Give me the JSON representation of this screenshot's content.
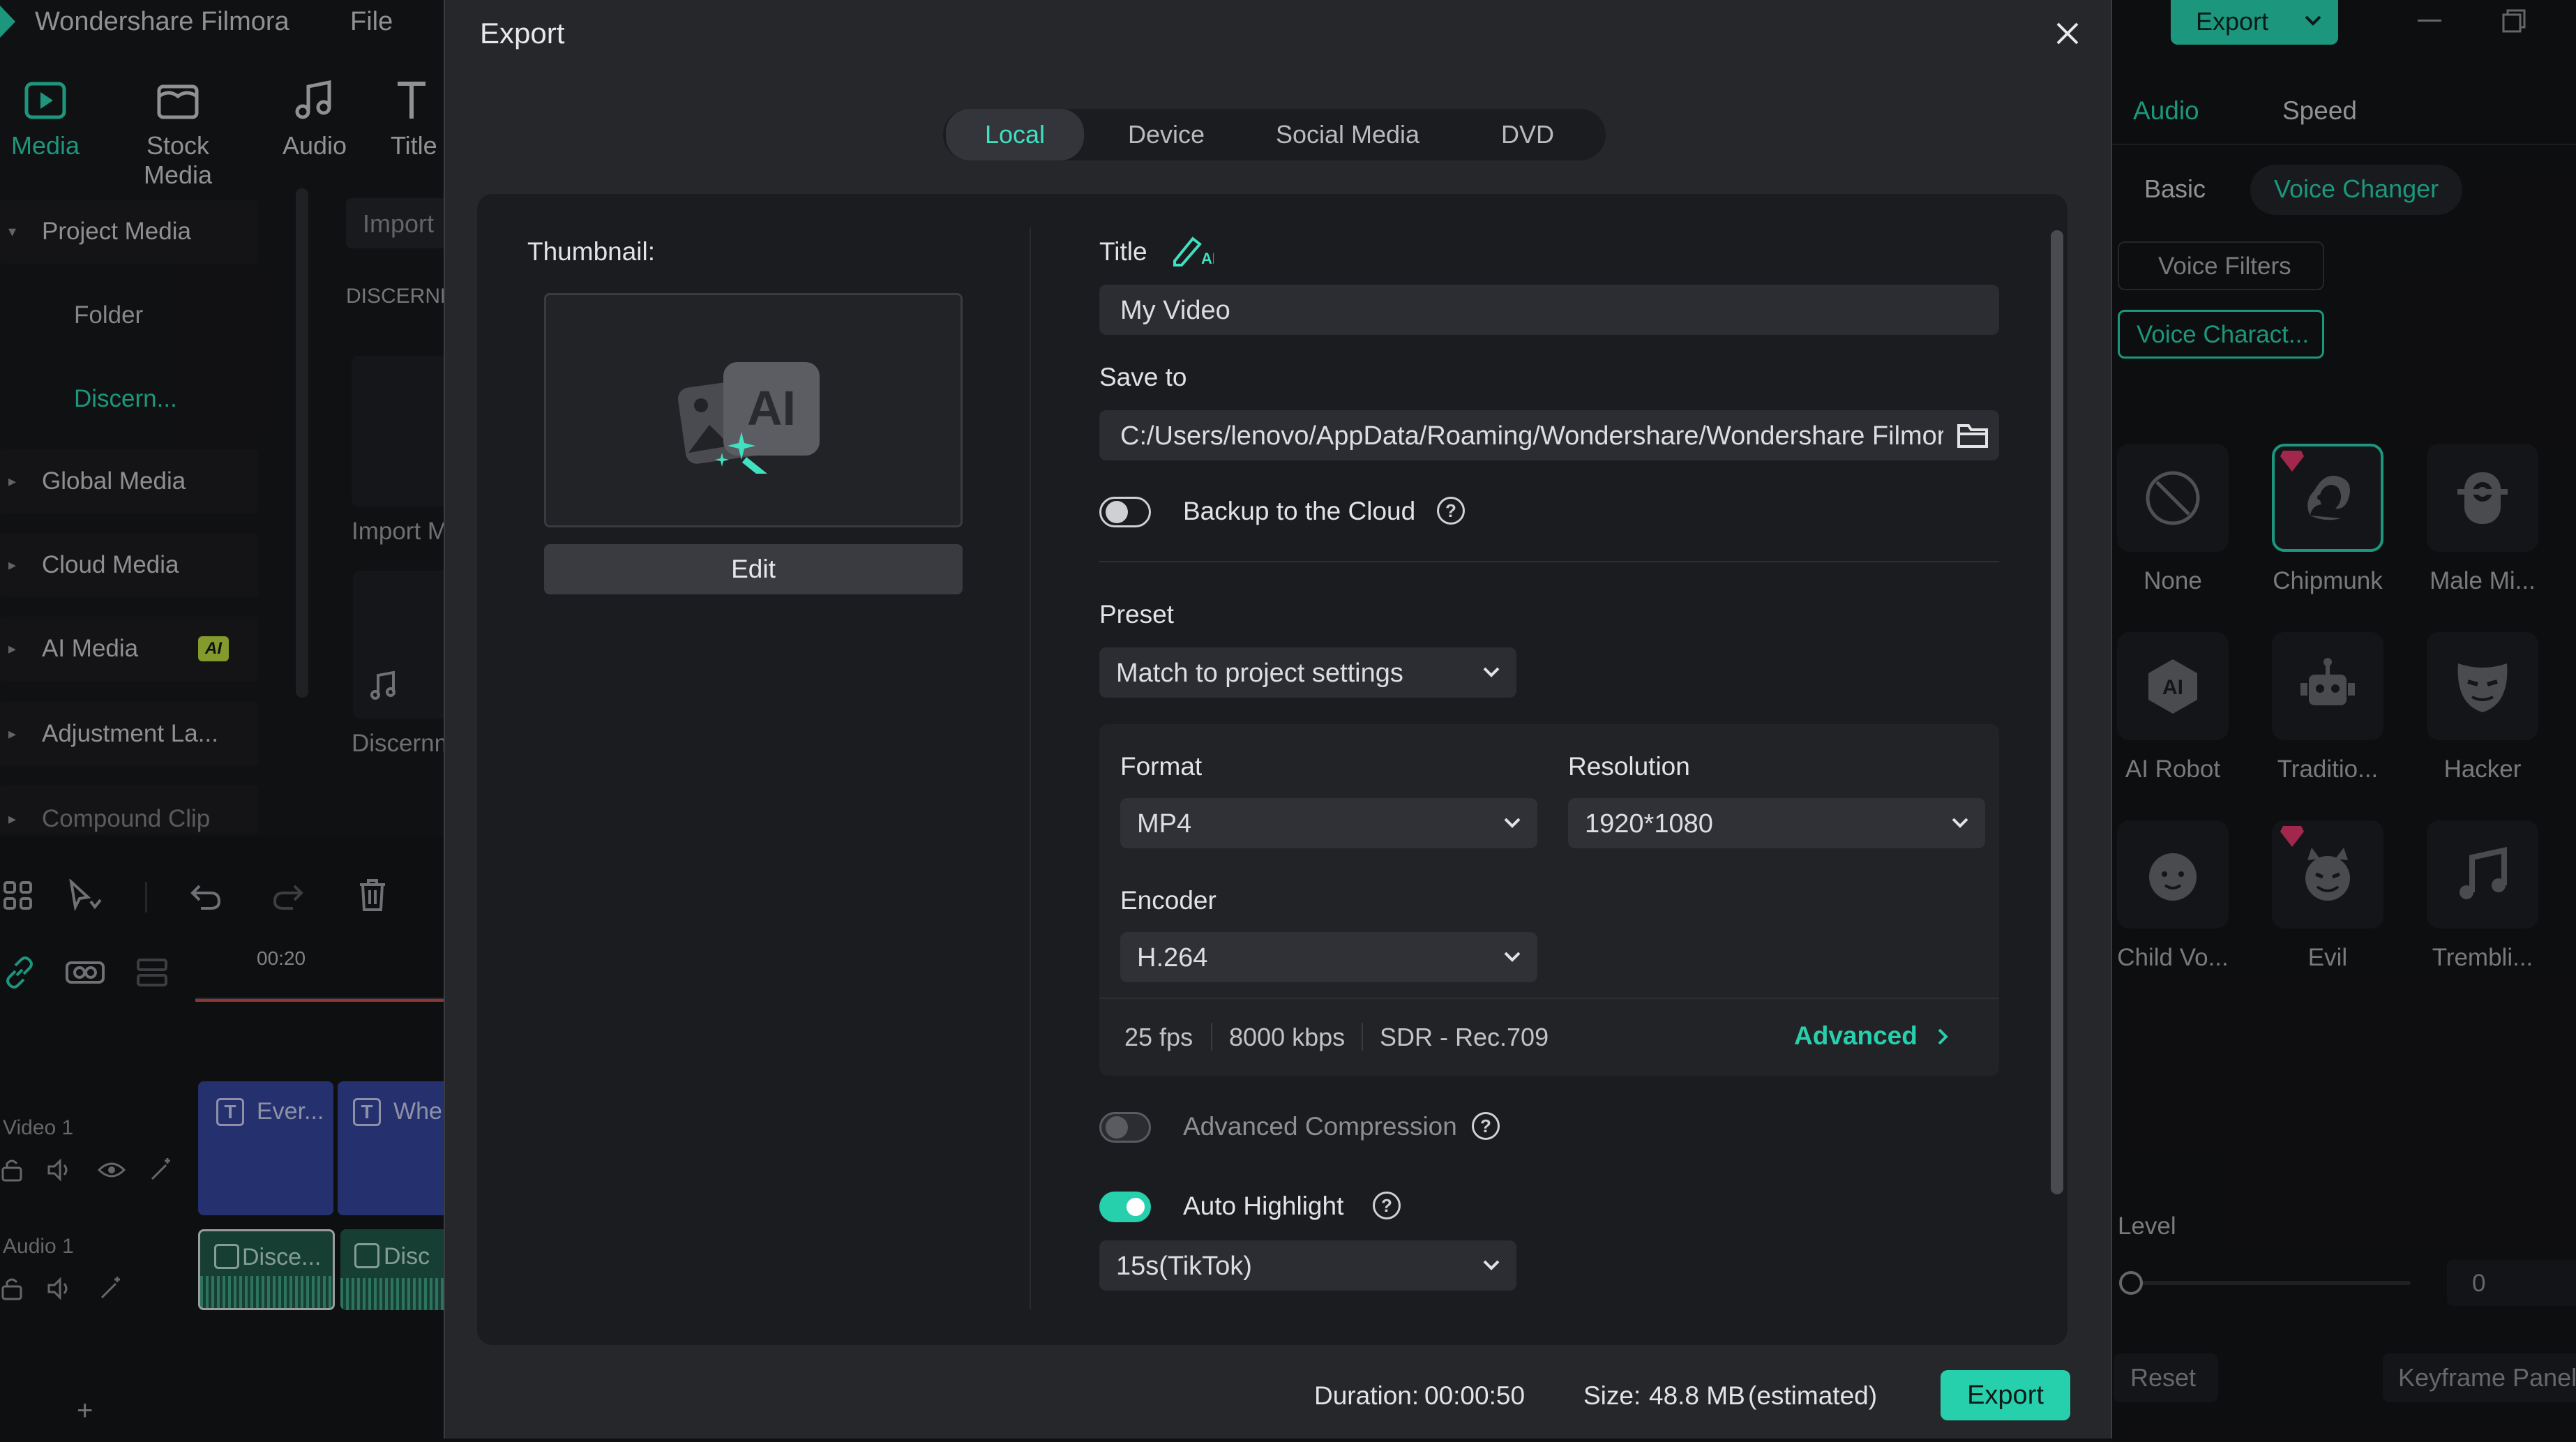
{
  "app": {
    "name": "Wondershare Filmora",
    "menu": [
      "File"
    ],
    "top_export_label": "Export",
    "media_tabs": [
      {
        "label": "Media",
        "icon": "media-icon"
      },
      {
        "label": "Stock Media",
        "icon": "stock-media-icon"
      },
      {
        "label": "Audio",
        "icon": "music-note-icon"
      },
      {
        "label": "Title",
        "icon": "title-icon"
      }
    ],
    "tree": [
      {
        "label": "Project Media",
        "expanded": true
      },
      {
        "label": "Folder"
      },
      {
        "label": "Discern..."
      },
      {
        "label": "Global Media"
      },
      {
        "label": "Cloud Media"
      },
      {
        "label": "AI Media",
        "badge": "AI"
      },
      {
        "label": "Adjustment La..."
      },
      {
        "label": "Compound Clip"
      }
    ],
    "import_label": "Import",
    "discern_header": "DISCERNM",
    "import_media_label": "Import M",
    "discern_item": "Discernm",
    "timeline": {
      "time_marker": "00:20",
      "video_track": "Video 1",
      "audio_track": "Audio 1",
      "clips": [
        "Ever...",
        "Whe"
      ],
      "audio_clips": [
        "Disce...",
        "Disc"
      ]
    },
    "right_panel": {
      "tabs": [
        "Audio",
        "Speed"
      ],
      "subtabs": [
        "Basic",
        "Voice Changer"
      ],
      "filters": [
        "Voice Filters",
        "Voice Charact..."
      ],
      "voices": [
        {
          "name": "None",
          "icon": "none-icon"
        },
        {
          "name": "Chipmunk",
          "icon": "squirrel-icon",
          "selected": true,
          "premium": true
        },
        {
          "name": "Male Mi...",
          "icon": "minion-icon"
        },
        {
          "name": "AI Robot",
          "icon": "ai-robot-icon"
        },
        {
          "name": "Traditio...",
          "icon": "robot-icon"
        },
        {
          "name": "Hacker",
          "icon": "mask-icon"
        },
        {
          "name": "Child Vo...",
          "icon": "child-face-icon"
        },
        {
          "name": "Evil",
          "icon": "devil-face-icon",
          "premium": true
        },
        {
          "name": "Trembli...",
          "icon": "music-notes-icon"
        }
      ],
      "level_label": "Level",
      "level_value": "0",
      "reset_label": "Reset",
      "keyframe_label": "Keyframe Panel"
    }
  },
  "dialog": {
    "title": "Export",
    "tabs": [
      "Local",
      "Device",
      "Social Media",
      "DVD"
    ],
    "active_tab": "Local",
    "thumbnail_label": "Thumbnail:",
    "edit_label": "Edit",
    "title_label": "Title",
    "title_value": "My Video",
    "save_to_label": "Save to",
    "save_to_value": "C:/Users/lenovo/AppData/Roaming/Wondershare/Wondershare Filmora",
    "backup_label": "Backup to the Cloud",
    "backup_on": false,
    "preset_label": "Preset",
    "preset_value": "Match to project settings",
    "format_label": "Format",
    "format_value": "MP4",
    "resolution_label": "Resolution",
    "resolution_value": "1920*1080",
    "encoder_label": "Encoder",
    "encoder_value": "H.264",
    "fps": "25 fps",
    "bitrate": "8000 kbps",
    "color": "SDR - Rec.709",
    "advanced_label": "Advanced",
    "adv_compression_label": "Advanced Compression",
    "adv_compression_on": false,
    "auto_highlight_label": "Auto Highlight",
    "auto_highlight_on": true,
    "highlight_value": "15s(TikTok)",
    "duration_label": "Duration:",
    "duration_value": "00:00:50",
    "size_label": "Size:",
    "size_value": "48.8 MB",
    "size_note": "(estimated)",
    "export_label": "Export"
  },
  "colors": {
    "accent": "#27d0ad",
    "dialog_bg": "#26272b",
    "panel_bg": "#1b1c20"
  }
}
